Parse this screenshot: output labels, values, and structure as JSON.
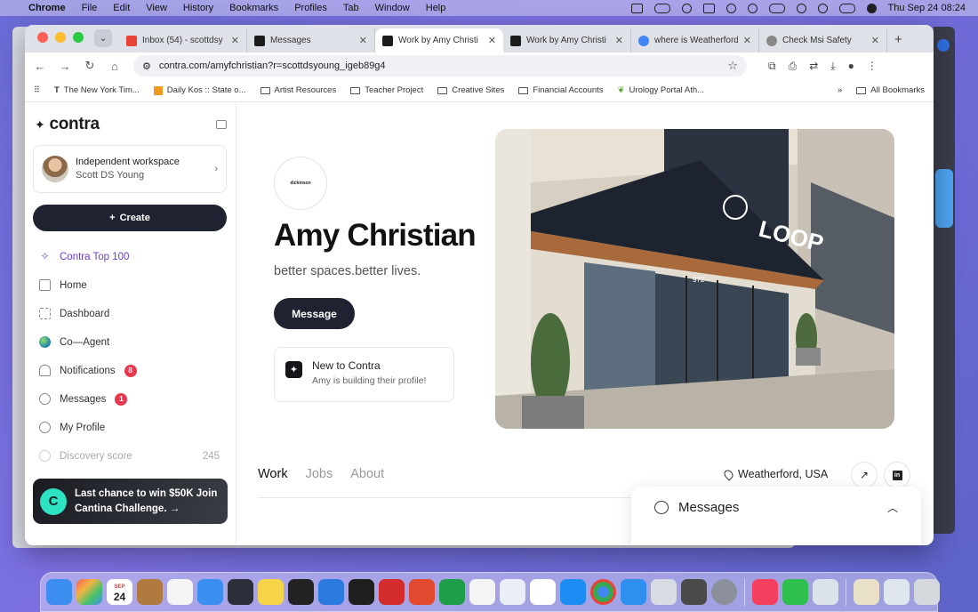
{
  "menubar": {
    "app": "Chrome",
    "menus": [
      "File",
      "Edit",
      "View",
      "History",
      "Bookmarks",
      "Profiles",
      "Tab",
      "Window",
      "Help"
    ],
    "clock": "Thu Sep 24  08:24"
  },
  "browser": {
    "tabs": [
      {
        "title": "Inbox (54) - scottdsy",
        "icon": "gmail-icon",
        "color": "#ea4335"
      },
      {
        "title": "Messages",
        "icon": "contra-icon",
        "color": "#1b1b1b"
      },
      {
        "title": "Work by Amy Christi",
        "icon": "contra-icon",
        "color": "#1b1b1b"
      },
      {
        "title": "Work by Amy Christi",
        "icon": "contra-icon",
        "color": "#1b1b1b"
      },
      {
        "title": "where is Weatherford",
        "icon": "google-icon",
        "color": "#4285f4"
      },
      {
        "title": "Check Msi Safety",
        "icon": "openai-icon",
        "color": "#666666"
      }
    ],
    "url": "contra.com/amyfchristian?r=scottdsyoung_igeb89g4",
    "bookmarks": [
      "The New York Tim...",
      "Daily Kos :: State o...",
      "Artist Resources",
      "Teacher Project",
      "Creative Sites",
      "Financial Accounts",
      "Urology Portal Ath..."
    ],
    "all_bookmarks": "All Bookmarks"
  },
  "sidebar": {
    "logo": "contra",
    "workspace": {
      "title": "Independent workspace",
      "name": "Scott DS Young"
    },
    "create": "Create",
    "nav": {
      "top100": "Contra Top 100",
      "home": "Home",
      "dashboard": "Dashboard",
      "coagent": "Co—Agent",
      "notifications": "Notifications",
      "notifications_count": "8",
      "messages": "Messages",
      "messages_count": "1",
      "profile": "My Profile",
      "discovery": "Discovery score",
      "discovery_value": "245"
    },
    "promo": "Last chance to win $50K Join Cantina Challenge. →"
  },
  "profile": {
    "brand_text": "dickinson",
    "name": "Amy Christian",
    "tagline": "better spaces.better lives.",
    "message_button": "Message",
    "card_title": "New to Contra",
    "card_sub": "Amy is building their profile!",
    "tabs": [
      "Work",
      "Jobs",
      "About"
    ],
    "location": "Weatherford, USA",
    "storefront_sign": "LOOP",
    "store_number": "972"
  },
  "chat": {
    "label": "Messages"
  },
  "dock": {
    "date_label": "SEP",
    "date_num": "24"
  },
  "colors": {
    "accent_dark": "#1f2230",
    "top100_purple": "#6a3ccf",
    "badge_red": "#e8384f"
  }
}
